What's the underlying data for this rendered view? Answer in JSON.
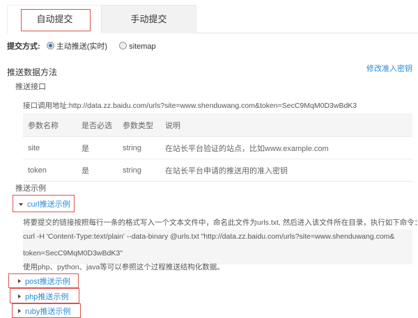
{
  "tabs": [
    {
      "label": "自动提交",
      "active": true
    },
    {
      "label": "手动提交",
      "active": false
    }
  ],
  "submit_method": {
    "label": "提交方式:",
    "options": [
      {
        "label": "主动推送(实时)",
        "selected": true
      },
      {
        "label": "sitemap",
        "selected": false
      }
    ]
  },
  "section_title": "推送数据方法",
  "modify_key_link": "修改准入密钥",
  "interface": {
    "title": "推送接口",
    "url_label": "接口调用地址:",
    "url": "http://data.zz.baidu.com/urls?site=www.shenduwang.com&token=SecC9MqM0D3wBdK3"
  },
  "table": {
    "headers": [
      "参数名称",
      "是否必选",
      "参数类型",
      "说明"
    ],
    "rows": [
      [
        "site",
        "是",
        "string",
        "在站长平台验证的站点，比如www.example.com"
      ],
      [
        "token",
        "是",
        "string",
        "在站长平台申请的推送用的准入密钥"
      ]
    ]
  },
  "examples": {
    "title": "推送示例",
    "curl": {
      "label": "curl推送示例",
      "description": "将要提交的链接按照每行一条的格式写入一个文本文件中，命名此文件为urls.txt, 然后进入该文件所在目录，执行如下命令：",
      "code_line1": "curl -H 'Content-Type:text/plain' --data-binary @urls.txt \"http://data.zz.baidu.com/urls?site=www.shenduwang.com&",
      "code_line2": "token=SecC9MqM0D3wBdK3\"",
      "note": "使用php、python、java等可以参照这个过程推送结构化数据。"
    },
    "others": [
      {
        "label": "post推送示例"
      },
      {
        "label": "php推送示例"
      },
      {
        "label": "ruby推送示例"
      }
    ]
  },
  "colors": {
    "link": "#2a8ad4",
    "highlight_box": "#d9534f"
  }
}
